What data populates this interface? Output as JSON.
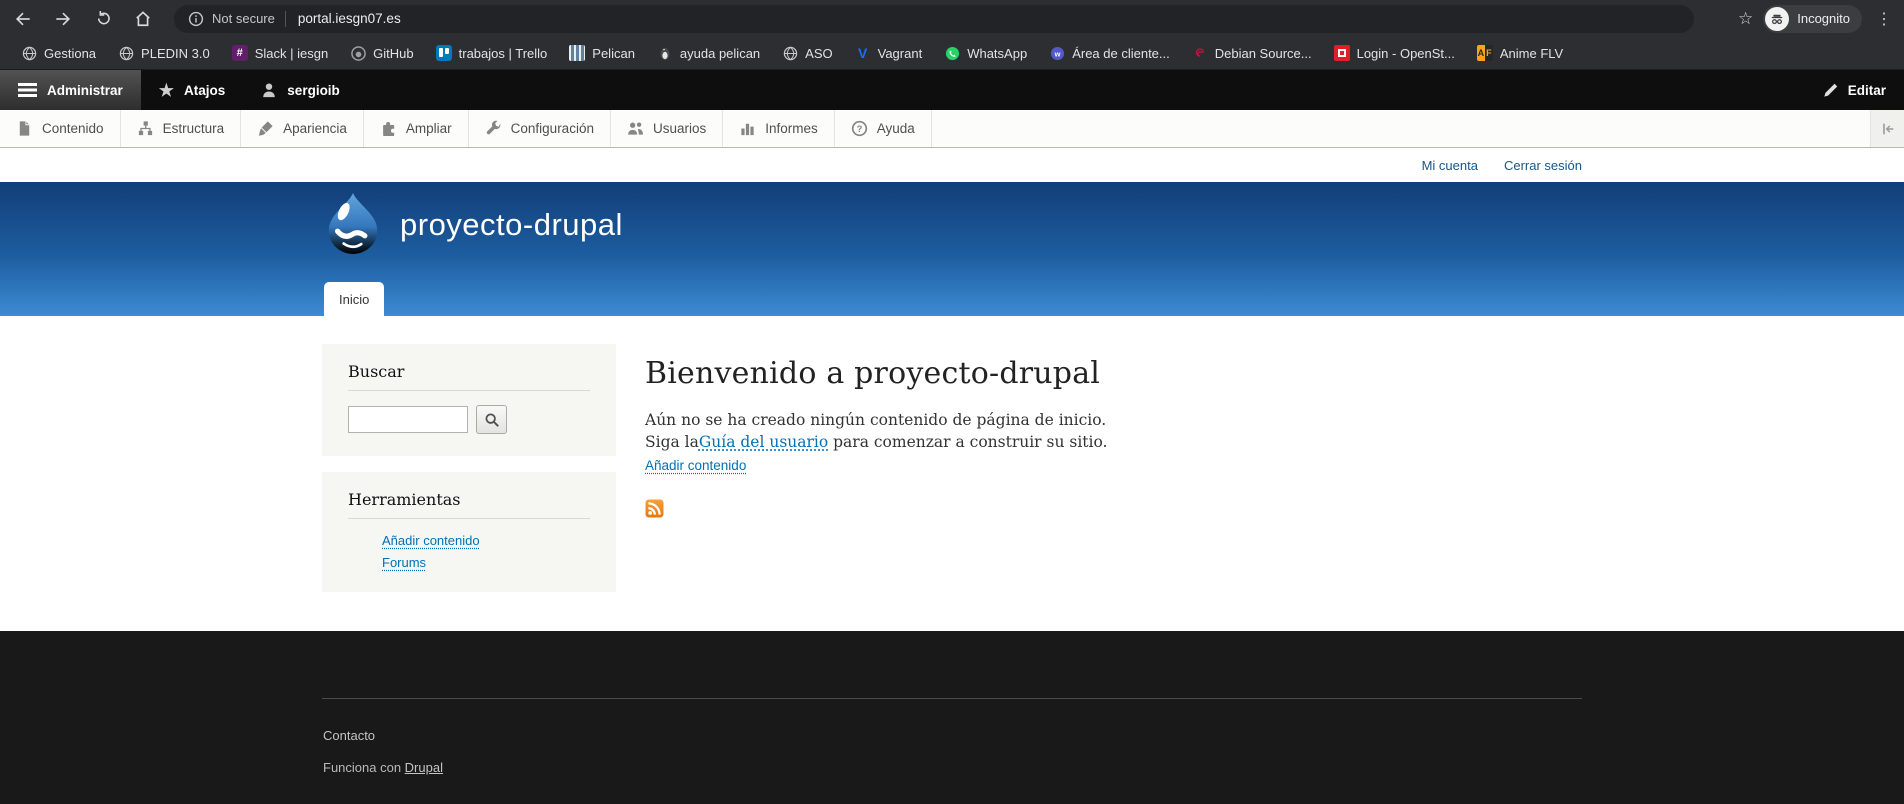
{
  "browser": {
    "security_label": "Not secure",
    "address": "portal.iesgn07.es",
    "incognito_label": "Incognito",
    "bookmarks": [
      {
        "label": "Gestiona"
      },
      {
        "label": "PLEDIN 3.0"
      },
      {
        "label": "Slack | iesgn"
      },
      {
        "label": "GitHub"
      },
      {
        "label": "trabajos | Trello"
      },
      {
        "label": "Pelican"
      },
      {
        "label": "ayuda pelican"
      },
      {
        "label": "ASO"
      },
      {
        "label": "Vagrant"
      },
      {
        "label": "WhatsApp"
      },
      {
        "label": "Área de cliente..."
      },
      {
        "label": "Debian Source..."
      },
      {
        "label": "Login - OpenSt..."
      },
      {
        "label": "Anime FLV"
      }
    ]
  },
  "admin_toolbar": {
    "manage_label": "Administrar",
    "shortcuts_label": "Atajos",
    "user_label": "sergioib",
    "edit_label": "Editar"
  },
  "admin_tabs": {
    "items": [
      {
        "label": "Contenido"
      },
      {
        "label": "Estructura"
      },
      {
        "label": "Apariencia"
      },
      {
        "label": "Ampliar"
      },
      {
        "label": "Configuración"
      },
      {
        "label": "Usuarios"
      },
      {
        "label": "Informes"
      },
      {
        "label": "Ayuda"
      }
    ]
  },
  "secondary_menu": {
    "my_account": "Mi cuenta",
    "logout": "Cerrar sesión"
  },
  "header": {
    "site_name": "proyecto-drupal",
    "home_tab": "Inicio"
  },
  "sidebar": {
    "search_title": "Buscar",
    "tools_title": "Herramientas",
    "tools_links": [
      {
        "label": "Añadir contenido"
      },
      {
        "label": "Forums"
      }
    ]
  },
  "content": {
    "title": "Bienvenido a proyecto-drupal",
    "empty_text": "Aún no se ha creado ningún contenido de página de inicio.",
    "guide_prefix": "Siga la",
    "guide_link": "Guía del usuario",
    "guide_suffix": " para comenzar a construir su sitio.",
    "add_content": "Añadir contenido"
  },
  "footer": {
    "contact": "Contacto",
    "powered_prefix": "Funciona con ",
    "powered_link": "Drupal"
  },
  "colors": {
    "header_top": "#123e78",
    "header_bottom": "#3d8bd4",
    "link_blue": "#0071b3",
    "rss_orange": "#ee8310",
    "toolbar_black": "#0e0e0e"
  }
}
